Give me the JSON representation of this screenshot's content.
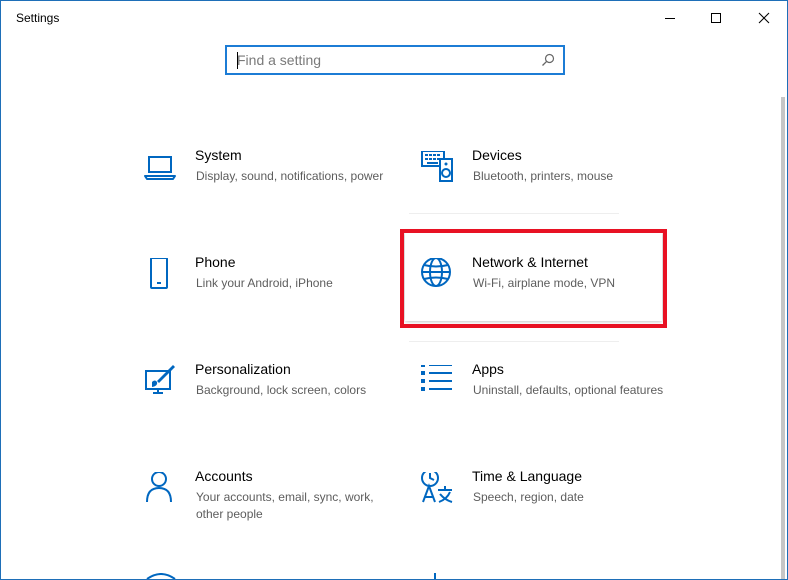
{
  "window": {
    "title": "Settings"
  },
  "search": {
    "placeholder": "Find a setting",
    "value": ""
  },
  "tiles": [
    {
      "id": "system",
      "title": "System",
      "description": "Display, sound, notifications, power",
      "icon": "laptop-icon"
    },
    {
      "id": "devices",
      "title": "Devices",
      "description": "Bluetooth, printers, mouse",
      "icon": "keyboard-speaker-icon"
    },
    {
      "id": "phone",
      "title": "Phone",
      "description": "Link your Android, iPhone",
      "icon": "phone-icon"
    },
    {
      "id": "network",
      "title": "Network & Internet",
      "description": "Wi-Fi, airplane mode, VPN",
      "icon": "globe-icon"
    },
    {
      "id": "personalization",
      "title": "Personalization",
      "description": "Background, lock screen, colors",
      "icon": "paint-brush-icon"
    },
    {
      "id": "apps",
      "title": "Apps",
      "description": "Uninstall, defaults, optional features",
      "icon": "apps-list-icon"
    },
    {
      "id": "accounts",
      "title": "Accounts",
      "description": "Your accounts, email, sync, work, other people",
      "icon": "person-icon"
    },
    {
      "id": "time-language",
      "title": "Time & Language",
      "description": "Speech, region, date",
      "icon": "time-language-icon"
    }
  ],
  "colors": {
    "accent": "#0067c0",
    "highlight": "#e81123",
    "description": "#5d5d5d"
  }
}
